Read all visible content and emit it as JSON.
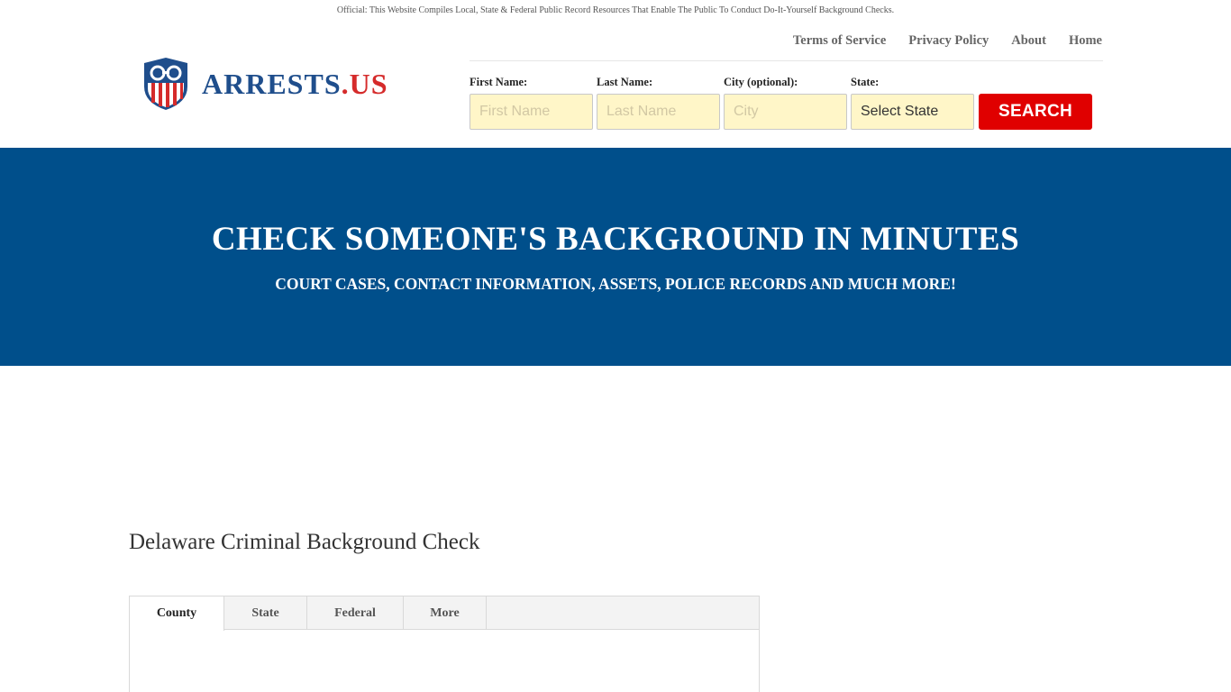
{
  "top_notice": "Official: This Website Compiles Local, State & Federal Public Record Resources That Enable The Public To Conduct Do-It-Yourself Background Checks.",
  "logo": {
    "name": "ARRESTS",
    "suffix": ".US"
  },
  "nav": [
    {
      "label": "Terms of Service"
    },
    {
      "label": "Privacy Policy"
    },
    {
      "label": "About"
    },
    {
      "label": "Home"
    }
  ],
  "search": {
    "first_name": {
      "label": "First Name:",
      "placeholder": "First Name"
    },
    "last_name": {
      "label": "Last Name:",
      "placeholder": "Last Name"
    },
    "city": {
      "label": "City (optional):",
      "placeholder": "City"
    },
    "state": {
      "label": "State:",
      "value": "Select State"
    },
    "button": "SEARCH"
  },
  "hero": {
    "title": "CHECK SOMEONE'S BACKGROUND IN MINUTES",
    "subtitle": "COURT CASES, CONTACT INFORMATION, ASSETS, POLICE RECORDS AND MUCH MORE!"
  },
  "page_title": "Delaware Criminal Background Check",
  "tabs": [
    {
      "label": "County",
      "active": true
    },
    {
      "label": "State",
      "active": false
    },
    {
      "label": "Federal",
      "active": false
    },
    {
      "label": "More",
      "active": false
    }
  ],
  "colors": {
    "brand_blue": "#004f8b",
    "brand_red": "#e00000",
    "input_bg": "#fff6c8"
  }
}
